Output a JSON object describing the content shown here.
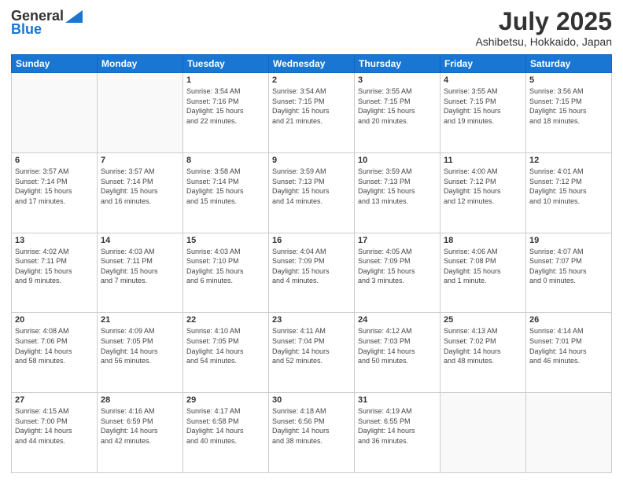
{
  "header": {
    "logo_general": "General",
    "logo_blue": "Blue",
    "month": "July 2025",
    "location": "Ashibetsu, Hokkaido, Japan"
  },
  "weekdays": [
    "Sunday",
    "Monday",
    "Tuesday",
    "Wednesday",
    "Thursday",
    "Friday",
    "Saturday"
  ],
  "weeks": [
    [
      {
        "day": "",
        "detail": ""
      },
      {
        "day": "",
        "detail": ""
      },
      {
        "day": "1",
        "detail": "Sunrise: 3:54 AM\nSunset: 7:16 PM\nDaylight: 15 hours\nand 22 minutes."
      },
      {
        "day": "2",
        "detail": "Sunrise: 3:54 AM\nSunset: 7:15 PM\nDaylight: 15 hours\nand 21 minutes."
      },
      {
        "day": "3",
        "detail": "Sunrise: 3:55 AM\nSunset: 7:15 PM\nDaylight: 15 hours\nand 20 minutes."
      },
      {
        "day": "4",
        "detail": "Sunrise: 3:55 AM\nSunset: 7:15 PM\nDaylight: 15 hours\nand 19 minutes."
      },
      {
        "day": "5",
        "detail": "Sunrise: 3:56 AM\nSunset: 7:15 PM\nDaylight: 15 hours\nand 18 minutes."
      }
    ],
    [
      {
        "day": "6",
        "detail": "Sunrise: 3:57 AM\nSunset: 7:14 PM\nDaylight: 15 hours\nand 17 minutes."
      },
      {
        "day": "7",
        "detail": "Sunrise: 3:57 AM\nSunset: 7:14 PM\nDaylight: 15 hours\nand 16 minutes."
      },
      {
        "day": "8",
        "detail": "Sunrise: 3:58 AM\nSunset: 7:14 PM\nDaylight: 15 hours\nand 15 minutes."
      },
      {
        "day": "9",
        "detail": "Sunrise: 3:59 AM\nSunset: 7:13 PM\nDaylight: 15 hours\nand 14 minutes."
      },
      {
        "day": "10",
        "detail": "Sunrise: 3:59 AM\nSunset: 7:13 PM\nDaylight: 15 hours\nand 13 minutes."
      },
      {
        "day": "11",
        "detail": "Sunrise: 4:00 AM\nSunset: 7:12 PM\nDaylight: 15 hours\nand 12 minutes."
      },
      {
        "day": "12",
        "detail": "Sunrise: 4:01 AM\nSunset: 7:12 PM\nDaylight: 15 hours\nand 10 minutes."
      }
    ],
    [
      {
        "day": "13",
        "detail": "Sunrise: 4:02 AM\nSunset: 7:11 PM\nDaylight: 15 hours\nand 9 minutes."
      },
      {
        "day": "14",
        "detail": "Sunrise: 4:03 AM\nSunset: 7:11 PM\nDaylight: 15 hours\nand 7 minutes."
      },
      {
        "day": "15",
        "detail": "Sunrise: 4:03 AM\nSunset: 7:10 PM\nDaylight: 15 hours\nand 6 minutes."
      },
      {
        "day": "16",
        "detail": "Sunrise: 4:04 AM\nSunset: 7:09 PM\nDaylight: 15 hours\nand 4 minutes."
      },
      {
        "day": "17",
        "detail": "Sunrise: 4:05 AM\nSunset: 7:09 PM\nDaylight: 15 hours\nand 3 minutes."
      },
      {
        "day": "18",
        "detail": "Sunrise: 4:06 AM\nSunset: 7:08 PM\nDaylight: 15 hours\nand 1 minute."
      },
      {
        "day": "19",
        "detail": "Sunrise: 4:07 AM\nSunset: 7:07 PM\nDaylight: 15 hours\nand 0 minutes."
      }
    ],
    [
      {
        "day": "20",
        "detail": "Sunrise: 4:08 AM\nSunset: 7:06 PM\nDaylight: 14 hours\nand 58 minutes."
      },
      {
        "day": "21",
        "detail": "Sunrise: 4:09 AM\nSunset: 7:05 PM\nDaylight: 14 hours\nand 56 minutes."
      },
      {
        "day": "22",
        "detail": "Sunrise: 4:10 AM\nSunset: 7:05 PM\nDaylight: 14 hours\nand 54 minutes."
      },
      {
        "day": "23",
        "detail": "Sunrise: 4:11 AM\nSunset: 7:04 PM\nDaylight: 14 hours\nand 52 minutes."
      },
      {
        "day": "24",
        "detail": "Sunrise: 4:12 AM\nSunset: 7:03 PM\nDaylight: 14 hours\nand 50 minutes."
      },
      {
        "day": "25",
        "detail": "Sunrise: 4:13 AM\nSunset: 7:02 PM\nDaylight: 14 hours\nand 48 minutes."
      },
      {
        "day": "26",
        "detail": "Sunrise: 4:14 AM\nSunset: 7:01 PM\nDaylight: 14 hours\nand 46 minutes."
      }
    ],
    [
      {
        "day": "27",
        "detail": "Sunrise: 4:15 AM\nSunset: 7:00 PM\nDaylight: 14 hours\nand 44 minutes."
      },
      {
        "day": "28",
        "detail": "Sunrise: 4:16 AM\nSunset: 6:59 PM\nDaylight: 14 hours\nand 42 minutes."
      },
      {
        "day": "29",
        "detail": "Sunrise: 4:17 AM\nSunset: 6:58 PM\nDaylight: 14 hours\nand 40 minutes."
      },
      {
        "day": "30",
        "detail": "Sunrise: 4:18 AM\nSunset: 6:56 PM\nDaylight: 14 hours\nand 38 minutes."
      },
      {
        "day": "31",
        "detail": "Sunrise: 4:19 AM\nSunset: 6:55 PM\nDaylight: 14 hours\nand 36 minutes."
      },
      {
        "day": "",
        "detail": ""
      },
      {
        "day": "",
        "detail": ""
      }
    ]
  ]
}
